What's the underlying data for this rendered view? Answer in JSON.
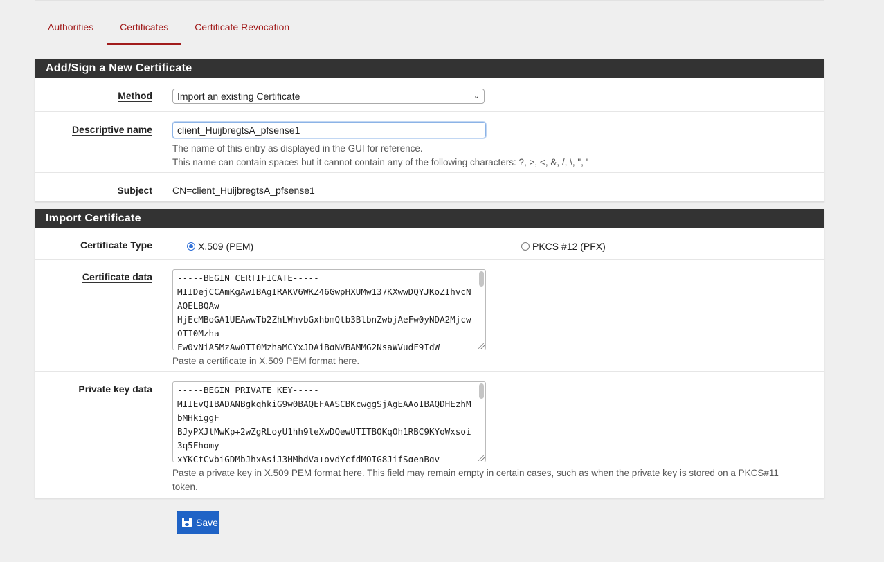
{
  "tabs": [
    {
      "label": "Authorities"
    },
    {
      "label": "Certificates"
    },
    {
      "label": "Certificate Revocation"
    }
  ],
  "add_panel": {
    "heading": "Add/Sign a New Certificate",
    "method": {
      "label": "Method",
      "value": "Import an existing Certificate"
    },
    "descriptive_name": {
      "label": "Descriptive name",
      "value": "client_HuijbregtsA_pfsense1",
      "help1": "The name of this entry as displayed in the GUI for reference.",
      "help2": "This name can contain spaces but it cannot contain any of the following characters: ?, >, <, &, /, \\, \", '"
    },
    "subject": {
      "label": "Subject",
      "value": "CN=client_HuijbregtsA_pfsense1"
    }
  },
  "import_panel": {
    "heading": "Import Certificate",
    "certificate_type": {
      "label": "Certificate Type",
      "option_x509": "X.509 (PEM)",
      "option_pkcs12": "PKCS #12 (PFX)",
      "selected": "X.509 (PEM)"
    },
    "certificate_data": {
      "label": "Certificate data",
      "value": "-----BEGIN CERTIFICATE-----\nMIIDejCCAmKgAwIBAgIRAKV6WKZ46GwpHXUMw137KXwwDQYJKoZIhvcNAQELBQAw\nHjEcMBoGA1UEAwwTb2ZhLWhvbGxhbmQtb3BlbnZwbjAeFw0yNDA2MjcwOTI0Mzha\nFw0yNjA5MzAwOTI0MzhaMCYxJDAiBgNVBAMMG2NsaWVudF9IdW",
      "help": "Paste a certificate in X.509 PEM format here."
    },
    "private_key_data": {
      "label": "Private key data",
      "value": "-----BEGIN PRIVATE KEY-----\nMIIEvQIBADANBgkqhkiG9w0BAQEFAASCBKcwggSjAgEAAoIBAQDHEzhMbMHkiggF\nBJyPXJtMwKp+2wZgRLoyU1hh9leXwDQewUTITBOKqOh1RBC9KYoWxsoi3q5Fhomy\nxYKCtCvbiGDMbJhxAsiJ3HMhdVa+ovdYcfdMOIG8JifSgenBgv",
      "help": "Paste a private key in X.509 PEM format here. This field may remain empty in certain cases, such as when the private key is stored on a PKCS#11 token."
    }
  },
  "save": {
    "label": "Save"
  },
  "colors": {
    "accent_red": "#a11b1b",
    "heading_bg": "#333333",
    "button_blue": "#1f63c6",
    "radio_blue": "#2f6fd8"
  },
  "icons": {
    "save": "floppy-disk-icon",
    "select": "chevron-down-icon"
  }
}
